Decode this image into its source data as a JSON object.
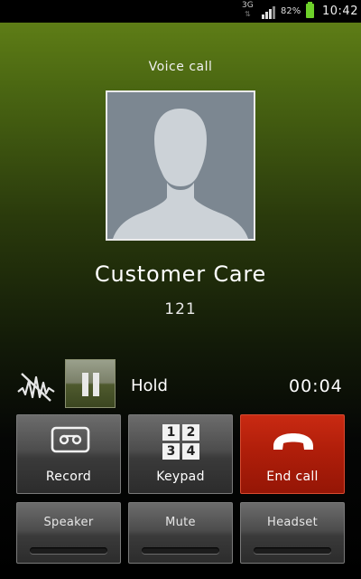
{
  "status_bar": {
    "network": "3G",
    "battery_percent": "82%",
    "time": "10:42",
    "icons": [
      "network-arrows-icon",
      "signal-strength-icon",
      "battery-icon"
    ]
  },
  "call": {
    "type": "Voice call",
    "contact_name": "Customer Care",
    "contact_number": "121",
    "hold_label": "Hold",
    "duration": "00:04"
  },
  "buttons": {
    "record": "Record",
    "keypad": "Keypad",
    "keypad_digits": [
      "1",
      "2",
      "3",
      "4"
    ],
    "end_call": "End call",
    "speaker": "Speaker",
    "mute": "Mute",
    "headset": "Headset"
  },
  "colors": {
    "end_call": "#b01e0a",
    "battery": "#6ed12a",
    "header_gradient_top": "#5e7d16"
  }
}
